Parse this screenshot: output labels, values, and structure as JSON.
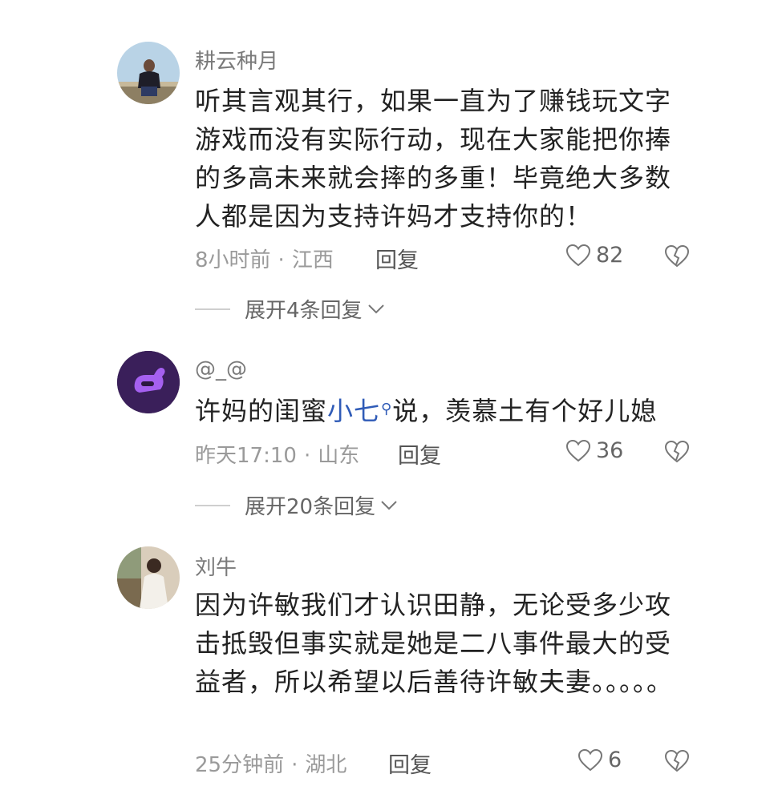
{
  "comments": [
    {
      "username": "耕云种月",
      "text": "听其言观其行，如果一直为了赚钱玩文字游戏而没有实际行动，现在大家能把你捧的多高未来就会摔的多重！毕竟绝大多数人都是因为支持许妈才支持你的！",
      "time": "8小时前",
      "location": "江西",
      "reply_label": "回复",
      "likes": "82",
      "expand_label": "展开4条回复"
    },
    {
      "username": "@_@",
      "text_before": "许妈的闺蜜",
      "mention": "小七",
      "text_after": "说，羡慕土有个好儿媳",
      "time": "昨天17:10",
      "location": "山东",
      "reply_label": "回复",
      "likes": "36",
      "expand_label": "展开20条回复"
    },
    {
      "username": "刘牛",
      "text": "因为许敏我们才认识田静，无论受多少攻击抵毁但事实就是她是二八事件最大的受益者，所以希望以后善待许敏夫妻。。。。。",
      "time": "25分钟前",
      "location": "湖北",
      "reply_label": "回复",
      "likes": "6"
    }
  ],
  "icons": {
    "like": "heart-outline-icon",
    "dislike": "broken-heart-icon",
    "expand": "chevron-down-icon",
    "mention_search": "search-icon"
  },
  "colors": {
    "mention": "#2f5bb7",
    "meta": "#9a9a9a"
  }
}
